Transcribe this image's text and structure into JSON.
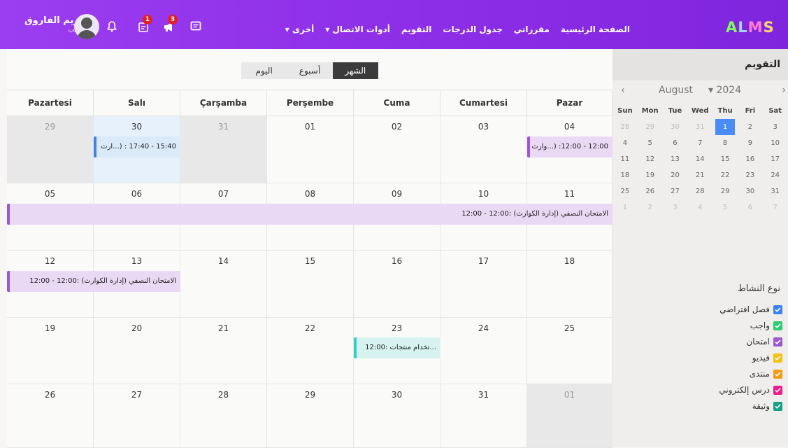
{
  "user": {
    "name": "كريم الفاروق",
    "role": "طالب"
  },
  "badges": {
    "notifications_icon_badge": "1",
    "megaphone_badge": "3"
  },
  "nav": [
    "الصفحة الرئيسية",
    "مقرراتي",
    "جدول الدرجات",
    "التقويم",
    "أدوات الاتصال",
    "أخرى"
  ],
  "logo": {
    "a": "A",
    "l": "L",
    "m": "M",
    "s": "S"
  },
  "view": {
    "month": "الشهر",
    "week": "أسبوع",
    "day": "اليوم",
    "active": "month"
  },
  "days_header": [
    "Pazartesi",
    "Salı",
    "Çarşamba",
    "Perşembe",
    "Cuma",
    "Cumartesi",
    "Pazar"
  ],
  "weeks": [
    [
      "29",
      "30",
      "31",
      "01",
      "02",
      "03",
      "04"
    ],
    [
      "05",
      "06",
      "07",
      "08",
      "09",
      "10",
      "11"
    ],
    [
      "12",
      "13",
      "14",
      "15",
      "16",
      "17",
      "18"
    ],
    [
      "19",
      "20",
      "21",
      "22",
      "23",
      "24",
      "25"
    ],
    [
      "26",
      "27",
      "28",
      "29",
      "30",
      "31",
      "01"
    ]
  ],
  "events": {
    "e1": "15:40 - 17:40 : (...ارث",
    "e2": "12:00 - 12:00: (...وارث",
    "e3": "الامتحان النصفي (إدارة الكوارث) :12:00 - 12:00",
    "e4": "الامتحان النصفي (إدارة الكوارث) :12:00 - 12:00",
    "e5": "...تخدام منتجات :12:00"
  },
  "colors": {
    "exam": "#9b59d0",
    "assignment": "#2ecc71",
    "lecture": "#3b82f6",
    "forum": "#f39c12",
    "video": "#f4c20d",
    "lesson": "#e91e8c",
    "document": "#16a085",
    "virtual": "#3b82f6",
    "event_teal": "#2dd4bf"
  },
  "sidebar": {
    "title": "التقويم",
    "month": "August",
    "year": "2024",
    "weekdays": [
      "Sun",
      "Mon",
      "Tue",
      "Wed",
      "Thu",
      "Fri",
      "Sat"
    ],
    "mini_weeks": [
      [
        "28",
        "29",
        "30",
        "31",
        "1",
        "2",
        "3"
      ],
      [
        "4",
        "5",
        "6",
        "7",
        "8",
        "9",
        "10"
      ],
      [
        "11",
        "12",
        "13",
        "14",
        "15",
        "16",
        "17"
      ],
      [
        "18",
        "19",
        "20",
        "21",
        "22",
        "23",
        "24"
      ],
      [
        "25",
        "26",
        "27",
        "28",
        "29",
        "30",
        "31"
      ],
      [
        "1",
        "2",
        "3",
        "4",
        "5",
        "6",
        "7"
      ]
    ],
    "legend_title": "نوع النشاط",
    "legend": [
      "فصل افتراضي",
      "واجب",
      "امتحان",
      "فيديو",
      "منتدى",
      "درس إلكتروني",
      "وثيقة"
    ]
  }
}
